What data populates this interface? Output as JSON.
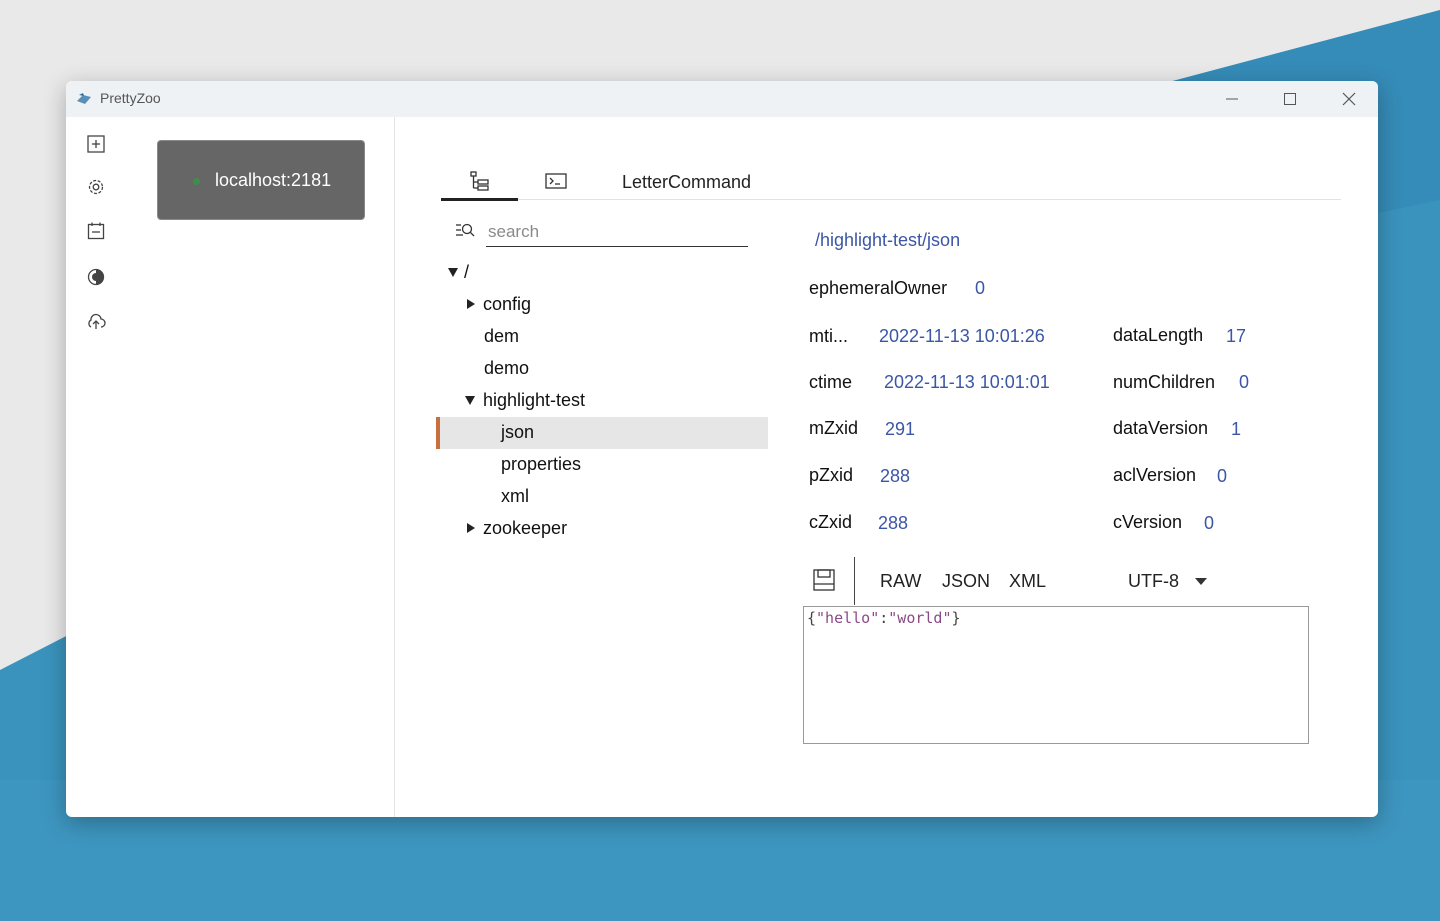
{
  "window": {
    "title": "PrettyZoo",
    "controls": {
      "minimize": "minimize-icon",
      "maximize": "maximize-icon",
      "close": "close-icon"
    }
  },
  "side_rail": {
    "icons": [
      "add-server-icon",
      "settings-icon",
      "log-icon",
      "theme-icon",
      "upload-icon"
    ]
  },
  "connection": {
    "label": "localhost:2181",
    "status_color": "#3e8e4a"
  },
  "tabs": [
    {
      "icon": "tree-icon",
      "label": "",
      "active": true
    },
    {
      "icon": "terminal-icon",
      "label": "",
      "active": false
    },
    {
      "icon": "",
      "label": "LetterCommand",
      "active": false
    }
  ],
  "search": {
    "placeholder": "search",
    "value": ""
  },
  "tree": [
    {
      "label": "/",
      "expanded": true,
      "selected": false
    },
    {
      "label": "config",
      "expanded": false,
      "selected": false
    },
    {
      "label": "dem",
      "selected": false
    },
    {
      "label": "demo",
      "selected": false
    },
    {
      "label": "highlight-test",
      "expanded": true,
      "selected": false
    },
    {
      "label": "json",
      "selected": true
    },
    {
      "label": "properties",
      "selected": false
    },
    {
      "label": "xml",
      "selected": false
    },
    {
      "label": "zookeeper",
      "expanded": false,
      "selected": false
    }
  ],
  "node": {
    "path": "/highlight-test/json",
    "ephemeralOwner": {
      "key": "ephemeralOwner",
      "value": "0"
    },
    "left": [
      {
        "key": "mti...",
        "value": "2022-11-13 10:01:26"
      },
      {
        "key": "ctime",
        "value": "2022-11-13 10:01:01"
      },
      {
        "key": "mZxid",
        "value": "291"
      },
      {
        "key": "pZxid",
        "value": "288"
      },
      {
        "key": "cZxid",
        "value": "288"
      }
    ],
    "right": [
      {
        "key": "dataLength",
        "value": "17"
      },
      {
        "key": "numChildren",
        "value": "0"
      },
      {
        "key": "dataVersion",
        "value": "1"
      },
      {
        "key": "aclVersion",
        "value": "0"
      },
      {
        "key": "cVersion",
        "value": "0"
      }
    ]
  },
  "formats": {
    "raw": "RAW",
    "json": "JSON",
    "xml": "XML",
    "encoding": "UTF-8"
  },
  "editor": {
    "open_brace": "{",
    "key": "\"hello\"",
    "colon": ":",
    "value": "\"world\"",
    "close_brace": "}"
  },
  "colors": {
    "accent": "#3b56a6",
    "selection_marker": "#c8703c",
    "card": "#666666"
  }
}
